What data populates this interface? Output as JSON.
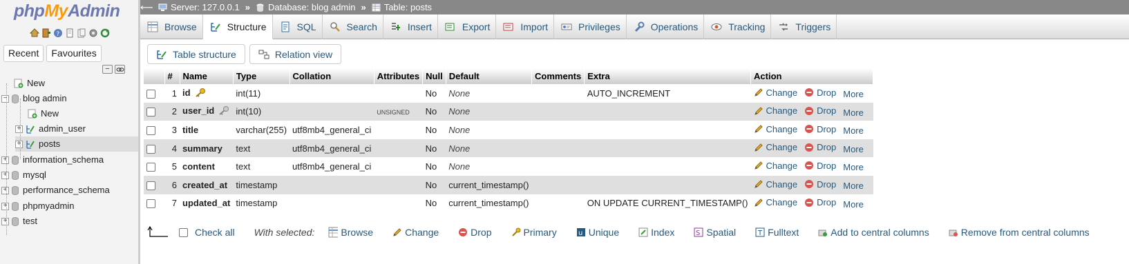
{
  "logo": {
    "php": "php",
    "my": "My",
    "admin": "Admin"
  },
  "left": {
    "recent": "Recent",
    "favourites": "Favourites",
    "tree": [
      {
        "label": "New",
        "type": "new"
      },
      {
        "label": "blog admin",
        "type": "db",
        "expanded": true
      },
      {
        "label": "New",
        "type": "new-child"
      },
      {
        "label": "admin_user",
        "type": "table"
      },
      {
        "label": "posts",
        "type": "table",
        "selected": true
      },
      {
        "label": "information_schema",
        "type": "db"
      },
      {
        "label": "mysql",
        "type": "db"
      },
      {
        "label": "performance_schema",
        "type": "db"
      },
      {
        "label": "phpmyadmin",
        "type": "db"
      },
      {
        "label": "test",
        "type": "db"
      }
    ]
  },
  "breadcrumb": {
    "server": "Server: 127.0.0.1",
    "database": "Database: blog admin",
    "table": "Table: posts",
    "sep": "»"
  },
  "tabs": [
    {
      "label": "Browse",
      "icon": "browse-icon"
    },
    {
      "label": "Structure",
      "icon": "structure-icon",
      "active": true
    },
    {
      "label": "SQL",
      "icon": "sql-icon"
    },
    {
      "label": "Search",
      "icon": "search-icon"
    },
    {
      "label": "Insert",
      "icon": "insert-icon"
    },
    {
      "label": "Export",
      "icon": "export-icon"
    },
    {
      "label": "Import",
      "icon": "import-icon"
    },
    {
      "label": "Privileges",
      "icon": "privileges-icon"
    },
    {
      "label": "Operations",
      "icon": "operations-icon"
    },
    {
      "label": "Tracking",
      "icon": "tracking-icon"
    },
    {
      "label": "Triggers",
      "icon": "triggers-icon"
    }
  ],
  "subtabs": {
    "table_structure": "Table structure",
    "relation_view": "Relation view"
  },
  "table": {
    "headers": [
      "#",
      "Name",
      "Type",
      "Collation",
      "Attributes",
      "Null",
      "Default",
      "Comments",
      "Extra",
      "Action"
    ],
    "rows": [
      {
        "num": "1",
        "name": "id",
        "key": "primary",
        "type": "int(11)",
        "collation": "",
        "attributes": "",
        "null": "No",
        "default": "None",
        "default_italic": true,
        "comments": "",
        "extra": "AUTO_INCREMENT"
      },
      {
        "num": "2",
        "name": "user_id",
        "key": "index",
        "type": "int(10)",
        "collation": "",
        "attributes": "UNSIGNED",
        "null": "No",
        "default": "None",
        "default_italic": true,
        "comments": "",
        "extra": ""
      },
      {
        "num": "3",
        "name": "title",
        "key": "",
        "type": "varchar(255)",
        "collation": "utf8mb4_general_ci",
        "attributes": "",
        "null": "No",
        "default": "None",
        "default_italic": true,
        "comments": "",
        "extra": ""
      },
      {
        "num": "4",
        "name": "summary",
        "key": "",
        "type": "text",
        "collation": "utf8mb4_general_ci",
        "attributes": "",
        "null": "No",
        "default": "None",
        "default_italic": true,
        "comments": "",
        "extra": ""
      },
      {
        "num": "5",
        "name": "content",
        "key": "",
        "type": "text",
        "collation": "utf8mb4_general_ci",
        "attributes": "",
        "null": "No",
        "default": "None",
        "default_italic": true,
        "comments": "",
        "extra": ""
      },
      {
        "num": "6",
        "name": "created_at",
        "key": "",
        "type": "timestamp",
        "collation": "",
        "attributes": "",
        "null": "No",
        "default": "current_timestamp()",
        "default_italic": false,
        "comments": "",
        "extra": ""
      },
      {
        "num": "7",
        "name": "updated_at",
        "key": "",
        "type": "timestamp",
        "collation": "",
        "attributes": "",
        "null": "No",
        "default": "current_timestamp()",
        "default_italic": false,
        "comments": "",
        "extra": "ON UPDATE CURRENT_TIMESTAMP()"
      }
    ],
    "actions": {
      "change": "Change",
      "drop": "Drop",
      "more": "More"
    }
  },
  "bottom": {
    "check_all": "Check all",
    "with_selected": "With selected:",
    "actions": [
      "Browse",
      "Change",
      "Drop",
      "Primary",
      "Unique",
      "Index",
      "Spatial",
      "Fulltext",
      "Add to central columns",
      "Remove from central columns"
    ]
  },
  "colors": {
    "link": "#235a81",
    "crumb_bg": "#888888",
    "drop_red": "#d9534f"
  }
}
